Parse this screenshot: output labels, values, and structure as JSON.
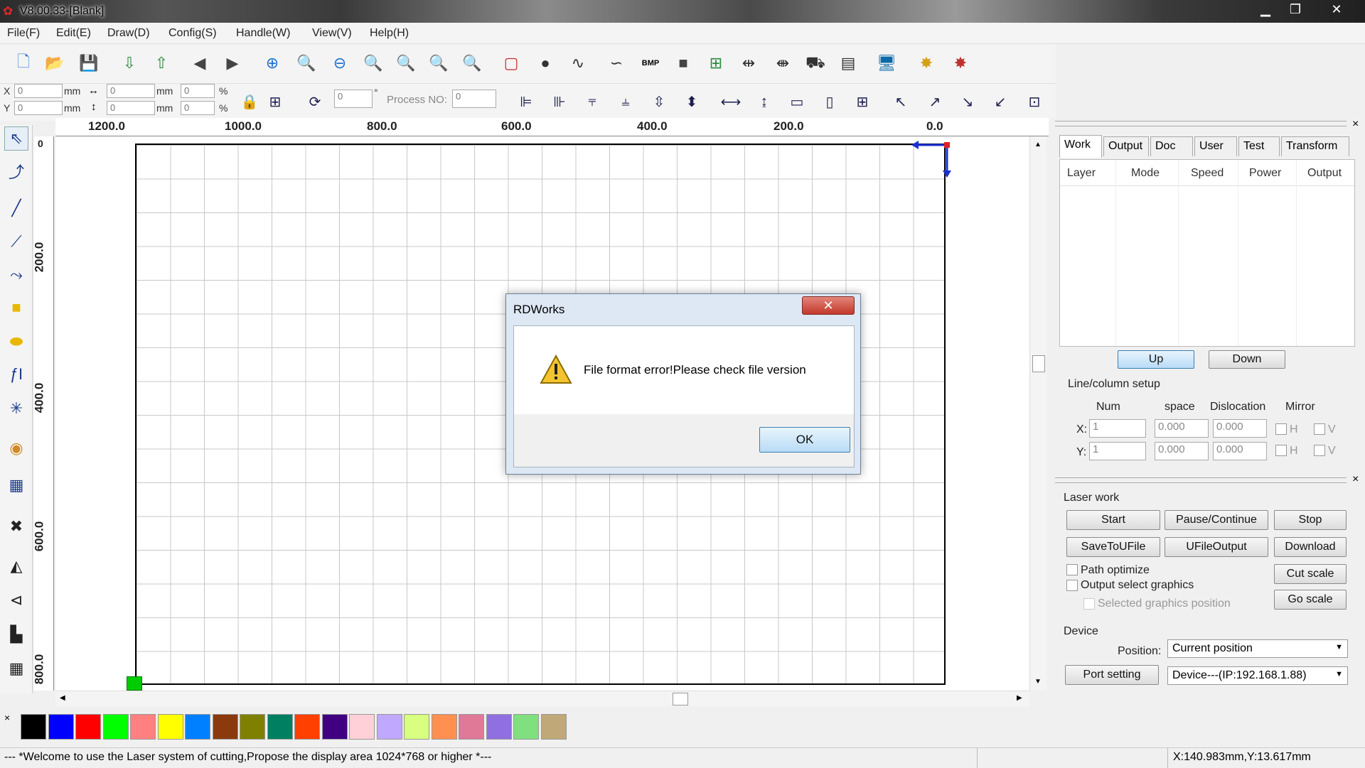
{
  "window": {
    "title": "V8.00.33-[Blank]",
    "controls": [
      "minimize",
      "restore",
      "close"
    ]
  },
  "menu": [
    "File(F)",
    "Edit(E)",
    "Draw(D)",
    "Config(S)",
    "Handle(W)",
    "View(V)",
    "Help(H)"
  ],
  "toolbar1": {
    "icons": [
      "new-file-icon",
      "open-folder-icon",
      "save-icon",
      "import-icon",
      "export-icon",
      "undo-icon",
      "redo-icon",
      "zoom-in-icon",
      "zoom-in-icon",
      "zoom-out-icon",
      "zoom-fit-icon",
      "zoom-page-icon",
      "zoom-select-icon",
      "zoom-icon",
      "select-box-icon",
      "node-icon",
      "smooth-icon",
      "curve-icon",
      "bmp-icon",
      "rect-fill-icon",
      "group-icon",
      "h-distribute-icon",
      "v-distribute-icon",
      "laser-head-icon",
      "layout-icon",
      "monitor-icon",
      "cluster-icon",
      "cluster2-icon"
    ],
    "bmp_label": "BMP"
  },
  "toolbar2": {
    "x_label": "X",
    "y_label": "Y",
    "x_value": "0",
    "y_value": "0",
    "unit": "mm",
    "w_value": "0",
    "h_value": "0",
    "sx_value": "0",
    "sy_value": "0",
    "percent": "%",
    "rotate_value": "0",
    "degree": "°",
    "process_no_label": "Process NO:",
    "process_no_value": "0"
  },
  "rulers": {
    "h_labels": [
      "1200.0",
      "1000.0",
      "800.0",
      "600.0",
      "400.0",
      "200.0",
      "0.0"
    ],
    "v_labels": [
      "0",
      "200.0",
      "400.0",
      "600.0",
      "800.0"
    ]
  },
  "palette": {
    "colors": [
      "#000000",
      "#0000ff",
      "#ff0000",
      "#00ff00",
      "#ff8080",
      "#ffff00",
      "#0080ff",
      "#8b3a0e",
      "#808000",
      "#008060",
      "#ff4000",
      "#400080",
      "#ffd0d8",
      "#c0a8ff",
      "#d8ff80",
      "#ff9050",
      "#e07898",
      "#9070e0",
      "#80e080",
      "#c0a878"
    ],
    "close": "×"
  },
  "status": {
    "message": "--- *Welcome to use the Laser system of cutting,Propose the display area 1024*768 or higher *---",
    "coords": "X:140.983mm,Y:13.617mm"
  },
  "panel": {
    "close": "×",
    "tabs": [
      "Work",
      "Output",
      "Doc",
      "User",
      "Test",
      "Transform"
    ],
    "layer_columns": [
      "Layer",
      "Mode",
      "Speed",
      "Power",
      "Output"
    ],
    "up": "Up",
    "down": "Down",
    "line_column": {
      "title": "Line/column setup",
      "headers": [
        "Num",
        "space",
        "Dislocation",
        "Mirror"
      ],
      "x_label": "X:",
      "y_label": "Y:",
      "x_num": "1",
      "x_space": "0.000",
      "x_disloc": "0.000",
      "y_num": "1",
      "y_space": "0.000",
      "y_disloc": "0.000",
      "mirror_h": "H",
      "mirror_v": "V"
    },
    "laser_work": {
      "title": "Laser work",
      "buttons": [
        "Start",
        "Pause/Continue",
        "Stop",
        "SaveToUFile",
        "UFileOutput",
        "Download"
      ],
      "path_optimize": "Path optimize",
      "output_select": "Output select graphics",
      "selected_position": "Selected graphics position",
      "cut_scale": "Cut scale",
      "go_scale": "Go scale"
    },
    "device": {
      "title": "Device",
      "position_label": "Position:",
      "position_value": "Current position",
      "port_setting": "Port setting",
      "device_value": "Device---(IP:192.168.1.88)"
    }
  },
  "dialog": {
    "title": "RDWorks",
    "message": "File format error!Please check file version",
    "ok": "OK",
    "close": "✕"
  }
}
